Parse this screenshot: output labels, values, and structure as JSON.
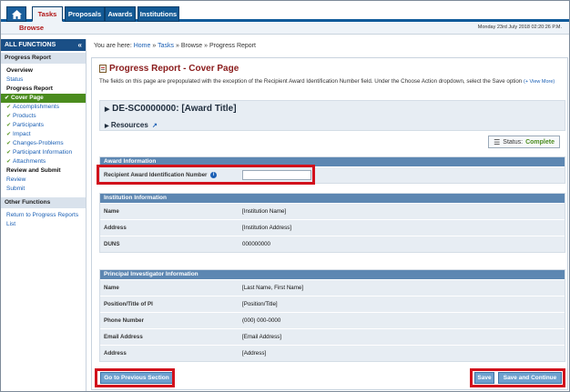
{
  "nav": {
    "tabs": [
      {
        "label": "Tasks",
        "active": true
      },
      {
        "label": "Proposals"
      },
      {
        "label": "Awards"
      },
      {
        "label": "Institutions"
      }
    ],
    "sub_tab": "Browse",
    "datetime": "Monday 23rd July 2018 02:20:26 P.M."
  },
  "sidebar": {
    "header": "ALL FUNCTIONS",
    "collapse_icon": "double-chevron-left-icon",
    "section1": "Progress Report",
    "items": [
      {
        "label": "Overview",
        "style": "black"
      },
      {
        "label": "Status",
        "style": "link"
      },
      {
        "label": "Progress Report",
        "style": "black"
      },
      {
        "label": "Cover Page",
        "style": "current"
      },
      {
        "label": "Accomplishments",
        "style": "check"
      },
      {
        "label": "Products",
        "style": "check"
      },
      {
        "label": "Participants",
        "style": "check"
      },
      {
        "label": "Impact",
        "style": "check"
      },
      {
        "label": "Changes-Problems",
        "style": "check"
      },
      {
        "label": "Participant Information",
        "style": "check"
      },
      {
        "label": "Attachments",
        "style": "check"
      },
      {
        "label": "Review and Submit",
        "style": "black"
      },
      {
        "label": "Review",
        "style": "link"
      },
      {
        "label": "Submit",
        "style": "link"
      }
    ],
    "section2": "Other Functions",
    "other_items": [
      "Return to Progress Reports",
      "List"
    ]
  },
  "breadcrumb": {
    "prefix": "You are here:",
    "home": "Home",
    "sep": "»",
    "tasks": "Tasks",
    "browse": "Browse",
    "current": "Progress Report"
  },
  "page": {
    "title": "Progress Report - Cover Page",
    "description": "The fields on this page are prepopulated with the exception of the Recipient Award Identification Number field. Under the Choose Action dropdown, select the Save option",
    "more": "(+ View More)",
    "award_title": "DE-SC0000000: [Award Title]",
    "resources": "Resources",
    "status_label": "Status:",
    "status_value": "Complete"
  },
  "award_info": {
    "heading": "Award Information",
    "field_label": "Recipient Award Identification Number",
    "field_value": ""
  },
  "institution": {
    "heading": "Institution Information",
    "rows": [
      {
        "label": "Name",
        "value": "[Institution Name]"
      },
      {
        "label": "Address",
        "value": "[Institution Address]"
      },
      {
        "label": "DUNS",
        "value": "000000000"
      }
    ]
  },
  "pi": {
    "heading": "Principal Investigator Information",
    "rows": [
      {
        "label": "Name",
        "value": "[Last Name, First Name]"
      },
      {
        "label": "Position/Title of PI",
        "value": "[Position/Title]"
      },
      {
        "label": "Phone Number",
        "value": "(000) 000-0000"
      },
      {
        "label": "Email Address",
        "value": "[Email Address]"
      },
      {
        "label": "Address",
        "value": "[Address]"
      }
    ]
  },
  "actions": {
    "prev": "Go to Previous Section",
    "save": "Save",
    "save_continue": "Save and Continue"
  },
  "colors": {
    "highlight": "#d1111c",
    "nav_blue": "#145a95",
    "complete_green": "#4b8c1e"
  }
}
